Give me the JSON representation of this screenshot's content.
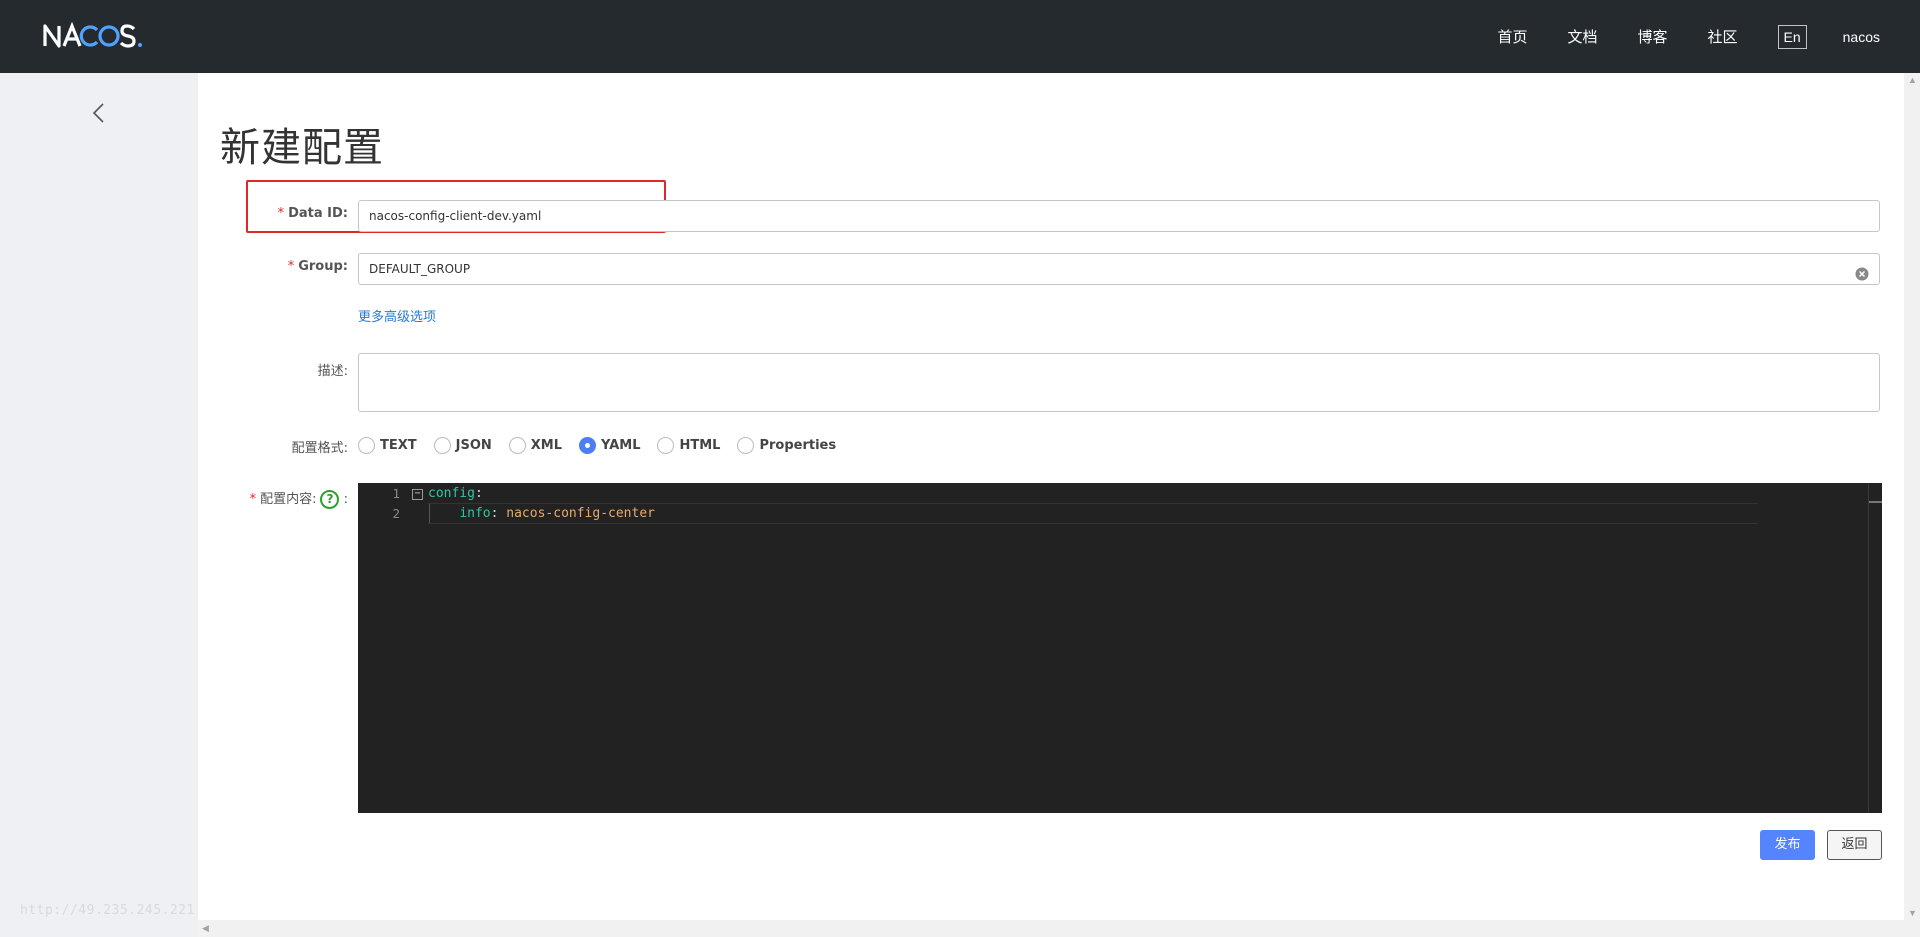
{
  "header": {
    "logo_text": "NACOS.",
    "nav": [
      "首页",
      "文档",
      "博客",
      "社区"
    ],
    "lang_button": "En",
    "user": "nacos"
  },
  "sidebar": {
    "url_hint": "http://49.235.245.221:"
  },
  "page": {
    "title": "新建配置"
  },
  "form": {
    "data_id": {
      "required_mark": "*",
      "label": "Data ID:",
      "value": "nacos-config-client-dev.yaml"
    },
    "group": {
      "required_mark": "*",
      "label": "Group:",
      "value": "DEFAULT_GROUP"
    },
    "advanced_link": "更多高级选项",
    "description": {
      "label": "描述:",
      "value": ""
    },
    "format": {
      "label": "配置格式:",
      "options": [
        "TEXT",
        "JSON",
        "XML",
        "YAML",
        "HTML",
        "Properties"
      ],
      "selected": "YAML"
    },
    "content": {
      "required_mark": "*",
      "label": "配置内容:",
      "help_glyph": "?",
      "colon": ":"
    }
  },
  "editor": {
    "lines": [
      {
        "no": "1",
        "key": "config",
        "sep": ":",
        "value": ""
      },
      {
        "no": "2",
        "indent": "    ",
        "key": "info",
        "sep": ": ",
        "value": "nacos-config-center"
      }
    ],
    "fold_glyph": "−"
  },
  "actions": {
    "publish": "发布",
    "back": "返回"
  },
  "colors": {
    "header_bg": "#252a2f",
    "primary": "#5584ff",
    "highlight": "#e02828",
    "editor_bg": "#222222",
    "yaml_key": "#36c2a4",
    "yaml_value": "#e8a96a",
    "help": "#2ca02c"
  }
}
